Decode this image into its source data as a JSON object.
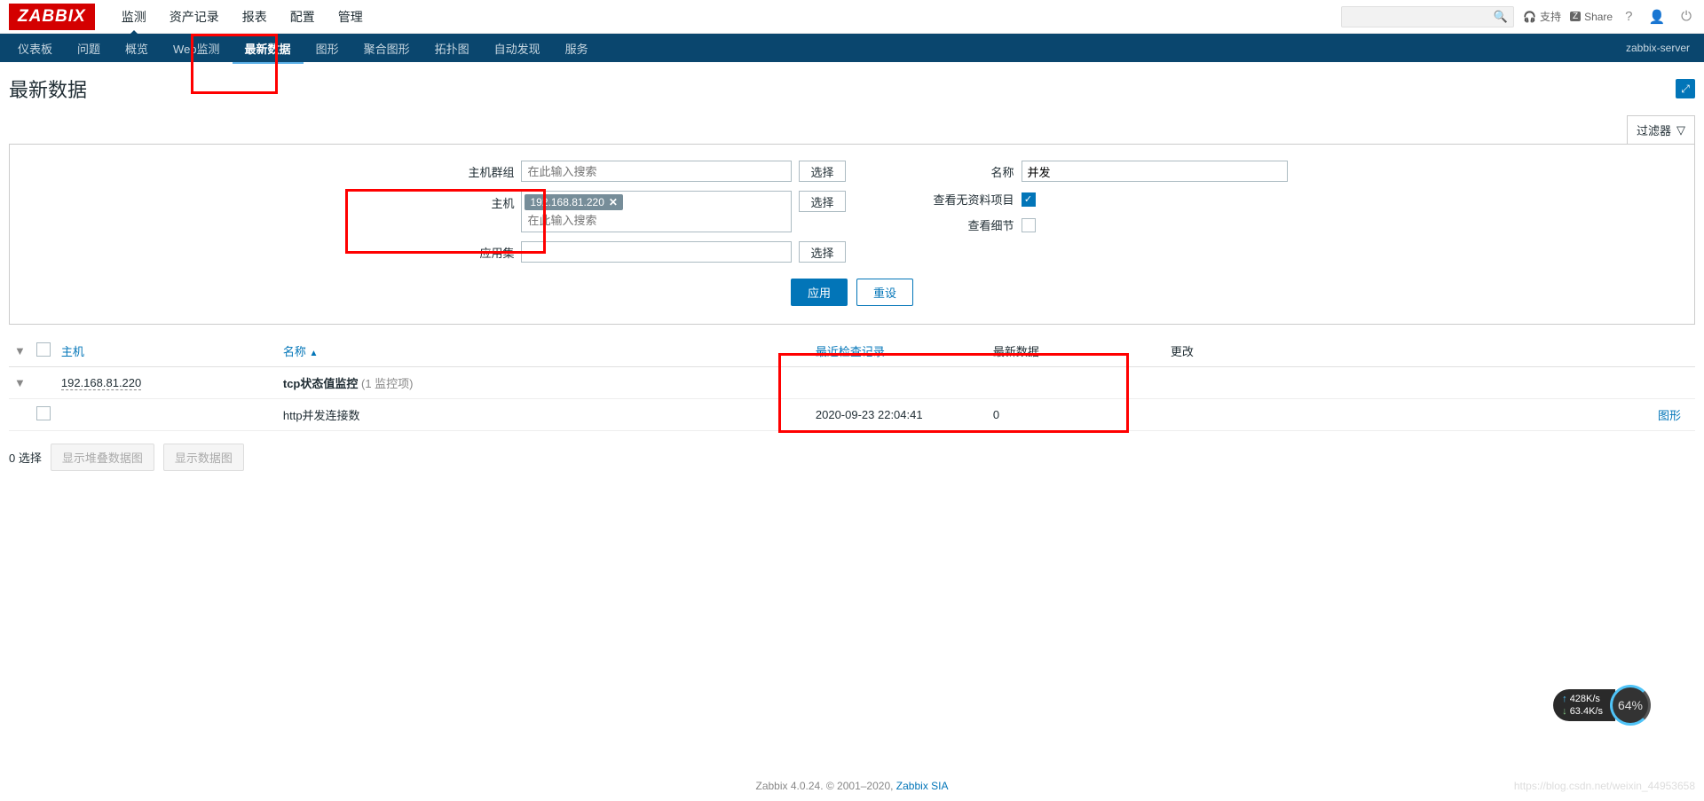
{
  "logo": "ZABBIX",
  "top_menu": [
    "监测",
    "资产记录",
    "报表",
    "配置",
    "管理"
  ],
  "top_menu_active": 0,
  "search_placeholder": "",
  "support_label": "支持",
  "share_label": "Share",
  "sub_menu": [
    "仪表板",
    "问题",
    "概览",
    "Web监测",
    "最新数据",
    "图形",
    "聚合图形",
    "拓扑图",
    "自动发现",
    "服务"
  ],
  "sub_menu_active": 4,
  "server_name": "zabbix-server",
  "page_title": "最新数据",
  "filter_toggle": "过滤器",
  "filter": {
    "hostgroup_label": "主机群组",
    "hostgroup_placeholder": "在此输入搜索",
    "hostgroup_select": "选择",
    "host_label": "主机",
    "host_tag": "192.168.81.220",
    "host_placeholder": "在此输入搜索",
    "host_select": "选择",
    "application_label": "应用集",
    "application_select": "选择",
    "name_label": "名称",
    "name_value": "并发",
    "show_without_data_label": "查看无资料项目",
    "show_without_data_checked": true,
    "show_details_label": "查看细节",
    "show_details_checked": false,
    "apply_btn": "应用",
    "reset_btn": "重设"
  },
  "table": {
    "headers": {
      "host": "主机",
      "name": "名称",
      "last_check": "最近检查记录",
      "last_data": "最新数据",
      "change": "更改"
    },
    "group_row": {
      "host": "192.168.81.220",
      "app_name": "tcp状态值监控",
      "item_count": "(1 监控项)"
    },
    "item_row": {
      "name": "http并发连接数",
      "last_check": "2020-09-23 22:04:41",
      "last_data": "0",
      "graph_link": "图形"
    }
  },
  "footer": {
    "selected": "0 选择",
    "stacked_btn": "显示堆叠数据图",
    "graph_btn": "显示数据图"
  },
  "copyright": {
    "text": "Zabbix 4.0.24. © 2001–2020, ",
    "link": "Zabbix SIA"
  },
  "net_widget": {
    "up": "428K/s",
    "down": "63.4K/s",
    "pct": "64%"
  },
  "watermark": "https://blog.csdn.net/weixin_44953658"
}
